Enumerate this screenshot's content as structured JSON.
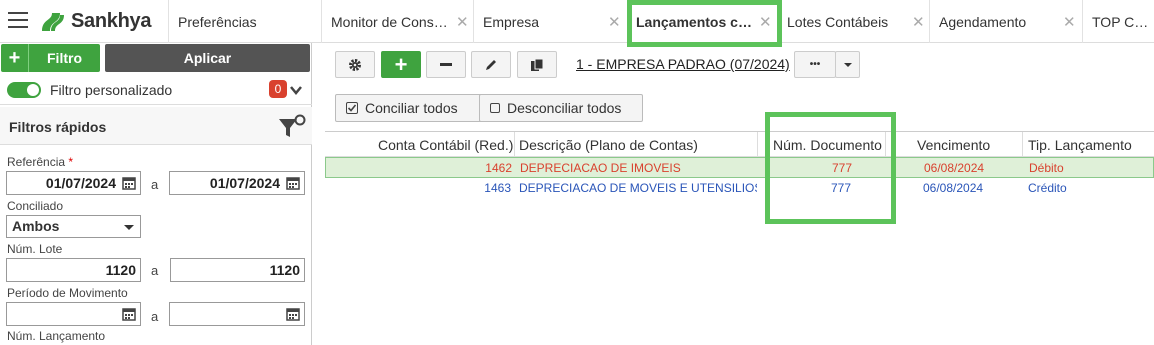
{
  "app": {
    "brand": "Sankhya"
  },
  "tabs": [
    {
      "label": "Preferências"
    },
    {
      "label": "Monitor de Consu..."
    },
    {
      "label": "Empresa"
    },
    {
      "label": "Lançamentos co...",
      "active": true
    },
    {
      "label": "Lotes Contábeis"
    },
    {
      "label": "Agendamento"
    },
    {
      "label": "TOP Conta"
    }
  ],
  "filter_panel": {
    "filter_button": "Filtro",
    "apply_button": "Aplicar",
    "custom_filter_label": "Filtro personalizado",
    "custom_filter_count": "0",
    "quick_filters_title": "Filtros rápidos",
    "referencia": {
      "label": "Referência",
      "required_mark": "*",
      "from": "01/07/2024",
      "to": "01/07/2024",
      "sep": "a"
    },
    "conciliado": {
      "label": "Conciliado",
      "value": "Ambos"
    },
    "num_lote": {
      "label": "Núm. Lote",
      "from": "1120",
      "to": "1120",
      "sep": "a"
    },
    "periodo": {
      "label": "Período de Movimento",
      "from": "",
      "to": "",
      "sep": "a"
    },
    "num_lancamento": {
      "label": "Núm. Lançamento"
    }
  },
  "toolbar": {
    "company": "1 - EMPRESA PADRAO (07/2024)",
    "more": "•••"
  },
  "actions": {
    "conciliar": "Conciliar todos",
    "desconciliar": "Desconciliar todos"
  },
  "grid": {
    "columns": [
      "Conta Contábil (Red.)",
      "Descrição (Plano de Contas)",
      "Núm. Documento",
      "Vencimento",
      "Tip. Lançamento"
    ],
    "rows": [
      {
        "conta": "1462",
        "descricao": "DEPRECIACAO DE IMOVEIS",
        "documento": "777",
        "vencimento": "06/08/2024",
        "tipo": "Débito"
      },
      {
        "conta": "1463",
        "descricao": "DEPRECIACAO DE MOVEIS E UTENSILIOS",
        "documento": "777",
        "vencimento": "06/08/2024",
        "tipo": "Crédito"
      }
    ]
  },
  "colors": {
    "accent_green": "#3fa33f",
    "debit": "#d9412e",
    "credit": "#2a55b8",
    "highlight": "#5cc35a"
  }
}
